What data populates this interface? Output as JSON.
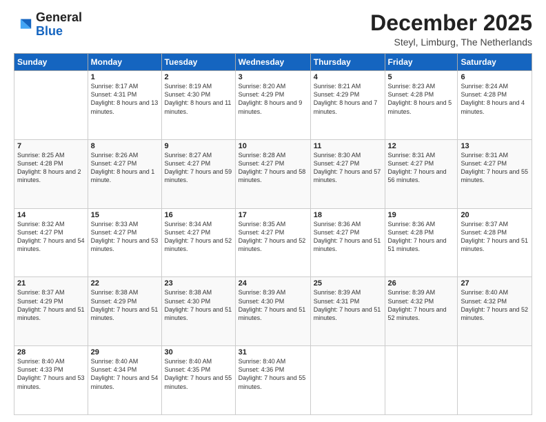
{
  "logo": {
    "general": "General",
    "blue": "Blue"
  },
  "header": {
    "month": "December 2025",
    "location": "Steyl, Limburg, The Netherlands"
  },
  "weekdays": [
    "Sunday",
    "Monday",
    "Tuesday",
    "Wednesday",
    "Thursday",
    "Friday",
    "Saturday"
  ],
  "weeks": [
    [
      {
        "day": "",
        "sunrise": "",
        "sunset": "",
        "daylight": ""
      },
      {
        "day": "1",
        "sunrise": "Sunrise: 8:17 AM",
        "sunset": "Sunset: 4:31 PM",
        "daylight": "Daylight: 8 hours and 13 minutes."
      },
      {
        "day": "2",
        "sunrise": "Sunrise: 8:19 AM",
        "sunset": "Sunset: 4:30 PM",
        "daylight": "Daylight: 8 hours and 11 minutes."
      },
      {
        "day": "3",
        "sunrise": "Sunrise: 8:20 AM",
        "sunset": "Sunset: 4:29 PM",
        "daylight": "Daylight: 8 hours and 9 minutes."
      },
      {
        "day": "4",
        "sunrise": "Sunrise: 8:21 AM",
        "sunset": "Sunset: 4:29 PM",
        "daylight": "Daylight: 8 hours and 7 minutes."
      },
      {
        "day": "5",
        "sunrise": "Sunrise: 8:23 AM",
        "sunset": "Sunset: 4:28 PM",
        "daylight": "Daylight: 8 hours and 5 minutes."
      },
      {
        "day": "6",
        "sunrise": "Sunrise: 8:24 AM",
        "sunset": "Sunset: 4:28 PM",
        "daylight": "Daylight: 8 hours and 4 minutes."
      }
    ],
    [
      {
        "day": "7",
        "sunrise": "Sunrise: 8:25 AM",
        "sunset": "Sunset: 4:28 PM",
        "daylight": "Daylight: 8 hours and 2 minutes."
      },
      {
        "day": "8",
        "sunrise": "Sunrise: 8:26 AM",
        "sunset": "Sunset: 4:27 PM",
        "daylight": "Daylight: 8 hours and 1 minute."
      },
      {
        "day": "9",
        "sunrise": "Sunrise: 8:27 AM",
        "sunset": "Sunset: 4:27 PM",
        "daylight": "Daylight: 7 hours and 59 minutes."
      },
      {
        "day": "10",
        "sunrise": "Sunrise: 8:28 AM",
        "sunset": "Sunset: 4:27 PM",
        "daylight": "Daylight: 7 hours and 58 minutes."
      },
      {
        "day": "11",
        "sunrise": "Sunrise: 8:30 AM",
        "sunset": "Sunset: 4:27 PM",
        "daylight": "Daylight: 7 hours and 57 minutes."
      },
      {
        "day": "12",
        "sunrise": "Sunrise: 8:31 AM",
        "sunset": "Sunset: 4:27 PM",
        "daylight": "Daylight: 7 hours and 56 minutes."
      },
      {
        "day": "13",
        "sunrise": "Sunrise: 8:31 AM",
        "sunset": "Sunset: 4:27 PM",
        "daylight": "Daylight: 7 hours and 55 minutes."
      }
    ],
    [
      {
        "day": "14",
        "sunrise": "Sunrise: 8:32 AM",
        "sunset": "Sunset: 4:27 PM",
        "daylight": "Daylight: 7 hours and 54 minutes."
      },
      {
        "day": "15",
        "sunrise": "Sunrise: 8:33 AM",
        "sunset": "Sunset: 4:27 PM",
        "daylight": "Daylight: 7 hours and 53 minutes."
      },
      {
        "day": "16",
        "sunrise": "Sunrise: 8:34 AM",
        "sunset": "Sunset: 4:27 PM",
        "daylight": "Daylight: 7 hours and 52 minutes."
      },
      {
        "day": "17",
        "sunrise": "Sunrise: 8:35 AM",
        "sunset": "Sunset: 4:27 PM",
        "daylight": "Daylight: 7 hours and 52 minutes."
      },
      {
        "day": "18",
        "sunrise": "Sunrise: 8:36 AM",
        "sunset": "Sunset: 4:27 PM",
        "daylight": "Daylight: 7 hours and 51 minutes."
      },
      {
        "day": "19",
        "sunrise": "Sunrise: 8:36 AM",
        "sunset": "Sunset: 4:28 PM",
        "daylight": "Daylight: 7 hours and 51 minutes."
      },
      {
        "day": "20",
        "sunrise": "Sunrise: 8:37 AM",
        "sunset": "Sunset: 4:28 PM",
        "daylight": "Daylight: 7 hours and 51 minutes."
      }
    ],
    [
      {
        "day": "21",
        "sunrise": "Sunrise: 8:37 AM",
        "sunset": "Sunset: 4:29 PM",
        "daylight": "Daylight: 7 hours and 51 minutes."
      },
      {
        "day": "22",
        "sunrise": "Sunrise: 8:38 AM",
        "sunset": "Sunset: 4:29 PM",
        "daylight": "Daylight: 7 hours and 51 minutes."
      },
      {
        "day": "23",
        "sunrise": "Sunrise: 8:38 AM",
        "sunset": "Sunset: 4:30 PM",
        "daylight": "Daylight: 7 hours and 51 minutes."
      },
      {
        "day": "24",
        "sunrise": "Sunrise: 8:39 AM",
        "sunset": "Sunset: 4:30 PM",
        "daylight": "Daylight: 7 hours and 51 minutes."
      },
      {
        "day": "25",
        "sunrise": "Sunrise: 8:39 AM",
        "sunset": "Sunset: 4:31 PM",
        "daylight": "Daylight: 7 hours and 51 minutes."
      },
      {
        "day": "26",
        "sunrise": "Sunrise: 8:39 AM",
        "sunset": "Sunset: 4:32 PM",
        "daylight": "Daylight: 7 hours and 52 minutes."
      },
      {
        "day": "27",
        "sunrise": "Sunrise: 8:40 AM",
        "sunset": "Sunset: 4:32 PM",
        "daylight": "Daylight: 7 hours and 52 minutes."
      }
    ],
    [
      {
        "day": "28",
        "sunrise": "Sunrise: 8:40 AM",
        "sunset": "Sunset: 4:33 PM",
        "daylight": "Daylight: 7 hours and 53 minutes."
      },
      {
        "day": "29",
        "sunrise": "Sunrise: 8:40 AM",
        "sunset": "Sunset: 4:34 PM",
        "daylight": "Daylight: 7 hours and 54 minutes."
      },
      {
        "day": "30",
        "sunrise": "Sunrise: 8:40 AM",
        "sunset": "Sunset: 4:35 PM",
        "daylight": "Daylight: 7 hours and 55 minutes."
      },
      {
        "day": "31",
        "sunrise": "Sunrise: 8:40 AM",
        "sunset": "Sunset: 4:36 PM",
        "daylight": "Daylight: 7 hours and 55 minutes."
      },
      {
        "day": "",
        "sunrise": "",
        "sunset": "",
        "daylight": ""
      },
      {
        "day": "",
        "sunrise": "",
        "sunset": "",
        "daylight": ""
      },
      {
        "day": "",
        "sunrise": "",
        "sunset": "",
        "daylight": ""
      }
    ]
  ]
}
